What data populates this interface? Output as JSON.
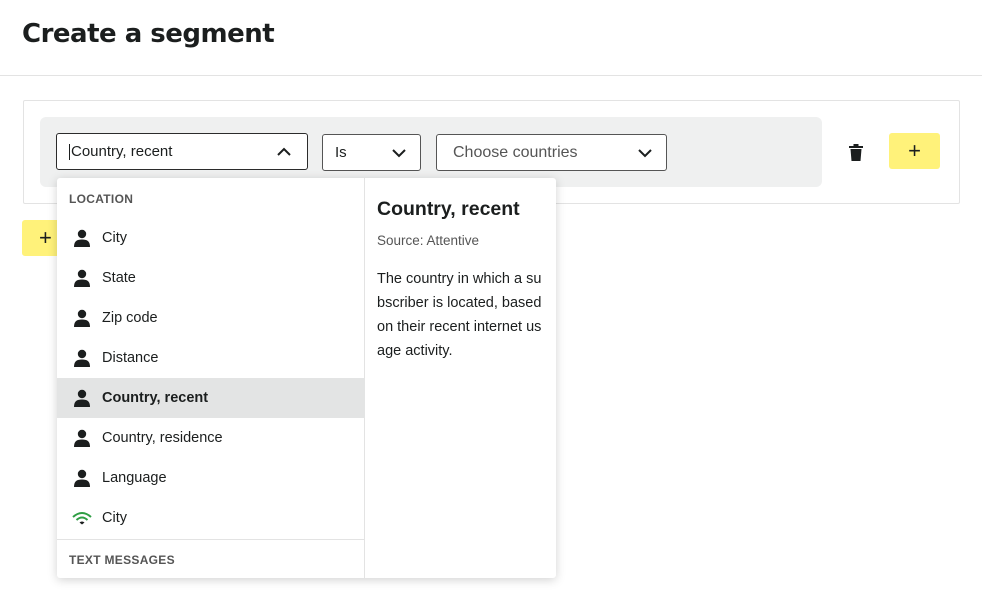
{
  "page": {
    "title": "Create a segment"
  },
  "condition": {
    "attribute_value": "Country, recent",
    "operator_value": "Is",
    "country_placeholder": "Choose countries"
  },
  "buttons": {
    "add_symbol": "+"
  },
  "dropdown": {
    "groups": [
      {
        "label": "LOCATION"
      },
      {
        "label": "TEXT MESSAGES"
      }
    ],
    "items": [
      {
        "label": "City",
        "icon": "person-icon"
      },
      {
        "label": "State",
        "icon": "person-icon"
      },
      {
        "label": "Zip code",
        "icon": "person-icon"
      },
      {
        "label": "Distance",
        "icon": "person-icon"
      },
      {
        "label": "Country, recent",
        "icon": "person-icon",
        "selected": true
      },
      {
        "label": "Country, residence",
        "icon": "person-icon"
      },
      {
        "label": "Language",
        "icon": "person-icon"
      },
      {
        "label": "City",
        "icon": "signal-icon"
      }
    ],
    "detail": {
      "title": "Country, recent",
      "source": "Source: Attentive",
      "description": "The country in which a subscriber is located, based on their recent internet usage activity."
    }
  },
  "colors": {
    "accent_yellow": "#fff27a",
    "row_background": "#eff0f0",
    "selected_item": "#e3e4e4",
    "signal_green": "#2f9e44"
  }
}
